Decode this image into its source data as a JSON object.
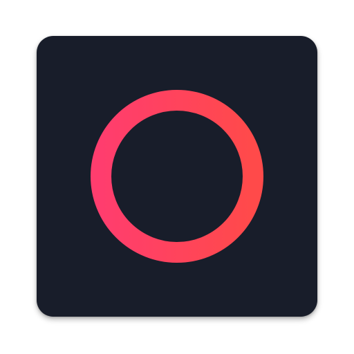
{
  "icon": {
    "semantic": "ring-icon",
    "background_color": "#181d2a",
    "ring_gradient": [
      "#ff3d6e",
      "#ff4a4a"
    ]
  }
}
